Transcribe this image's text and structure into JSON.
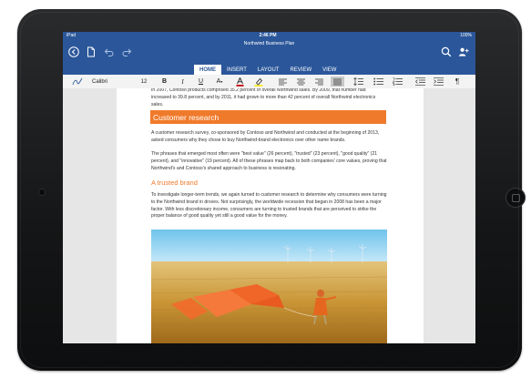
{
  "status": {
    "carrier": "iPad",
    "time": "2:46 PM",
    "battery": "100%"
  },
  "document": {
    "title": "Northwind Business Plan"
  },
  "tabs": [
    "HOME",
    "INSERT",
    "LAYOUT",
    "REVIEW",
    "VIEW"
  ],
  "active_tab": "HOME",
  "ribbon": {
    "font_name": "Calibri",
    "font_size": "12"
  },
  "content": {
    "p1": "In 2007, Contoso products comprised 35.2 percent of overall Northwind sales. By 2009, that number had increased to 39.8 percent, and by 2011, it had grown to more than 42 percent of overall Northwind electronics sales.",
    "h1": "Customer research",
    "p2": "A customer research survey, co-sponsored by Contoso and Northwind and conducted at the beginning of 2013, asked consumers why they chose to buy Northwind-brand electronics over other name brands.",
    "p3": "The phrases that emerged most often were \"best value\" (26 percent), \"trusted\" (23 percent), \"good quality\" (21 percent), and \"innovative\" (19 percent). All of these phrases map back to both companies' core values, proving that Northwind's and Contoso's shared approach to business is resonating.",
    "h2": "A trusted brand",
    "p4": "To investigate longer-term trends, we again turned to customer research to determine why consumers were turning to the Northwind brand in droves. Not surprisingly, the worldwide recession that began in 2008 has been a major factor. With less discretionary income, consumers are turning to trusted brands that are perceived to strike the proper balance of good quality yet still a good value for the money."
  },
  "colors": {
    "ribbon_blue": "#2b579a",
    "accent_orange": "#f07a2b"
  },
  "icons": [
    "back-arrow-icon",
    "file-icon",
    "undo-icon",
    "redo-icon",
    "search-icon",
    "share-person-icon",
    "pen-icon",
    "bold-icon",
    "italic-icon",
    "underline-icon",
    "font-color-icon",
    "highlight-icon",
    "align-left-icon",
    "align-center-icon",
    "align-right-icon",
    "justify-icon",
    "line-spacing-icon",
    "bullets-icon",
    "numbering-icon",
    "decrease-indent-icon",
    "increase-indent-icon",
    "paragraph-mark-icon"
  ]
}
